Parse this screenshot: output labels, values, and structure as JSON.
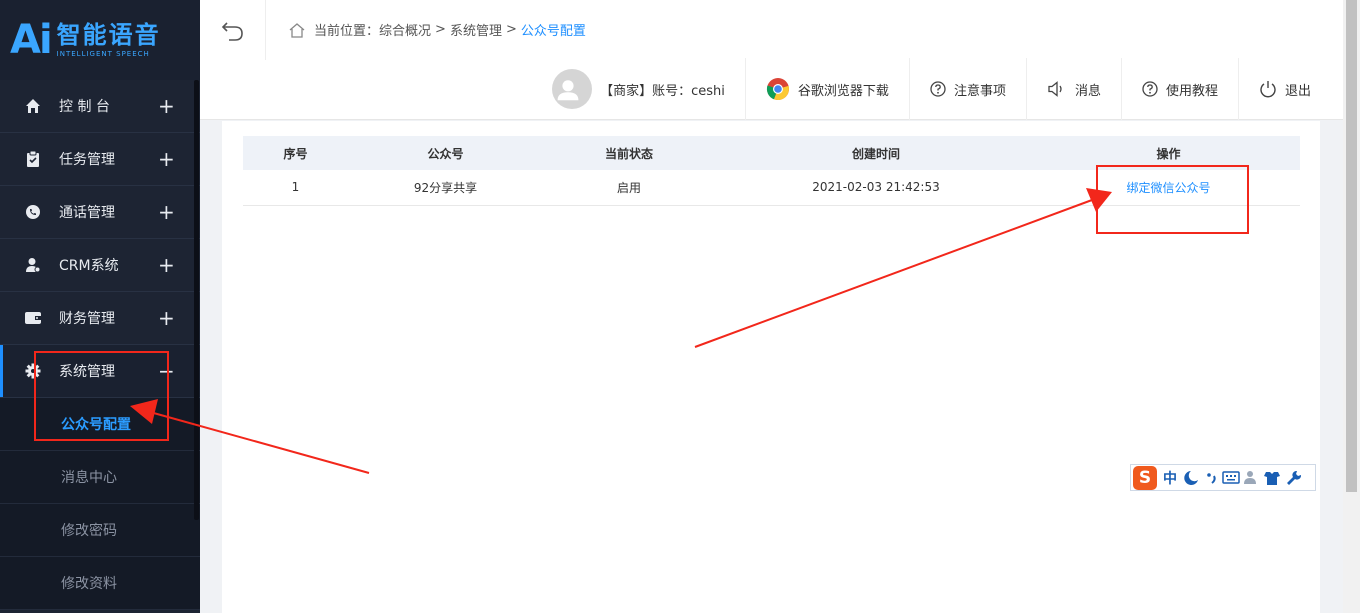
{
  "brand": {
    "logo_mark": "Ai",
    "name_cn": "智能语音",
    "name_en": "INTELLIGENT SPEECH",
    "color": "#3aa6ff"
  },
  "sidebar": {
    "items": [
      {
        "label": "控 制 台",
        "icon": "home-icon",
        "toggle": "+"
      },
      {
        "label": "任务管理",
        "icon": "clipboard-icon",
        "toggle": "+"
      },
      {
        "label": "通话管理",
        "icon": "phone-icon",
        "toggle": "+"
      },
      {
        "label": "CRM系统",
        "icon": "user-icon",
        "toggle": "+"
      },
      {
        "label": "财务管理",
        "icon": "wallet-icon",
        "toggle": "+"
      },
      {
        "label": "系统管理",
        "icon": "gear-icon",
        "toggle": "−"
      }
    ],
    "sub_items": [
      {
        "label": "公众号配置"
      },
      {
        "label": "消息中心"
      },
      {
        "label": "修改密码"
      },
      {
        "label": "修改资料"
      }
    ]
  },
  "breadcrumb": {
    "prefix": "当前位置：",
    "path1": "综合概况",
    "sep": ">",
    "path2": "系统管理",
    "current": "公众号配置"
  },
  "topbar": {
    "account": "【商家】账号：ceshi",
    "chrome": "谷歌浏览器下载",
    "notice": "注意事项",
    "message": "消息",
    "tutorial": "使用教程",
    "logout": "退出"
  },
  "table": {
    "headers": [
      "序号",
      "公众号",
      "当前状态",
      "创建时间",
      "操作"
    ],
    "rows": [
      {
        "index": "1",
        "account": "92分享共享",
        "status": "启用",
        "created": "2021-02-03 21:42:53",
        "action": "绑定微信公众号"
      }
    ]
  },
  "ime": {
    "logo": "S",
    "mode": "中"
  },
  "colors": {
    "accent": "#1e8fff",
    "annotation": "#f2271b",
    "sidebar_bg": "#1d2433"
  }
}
